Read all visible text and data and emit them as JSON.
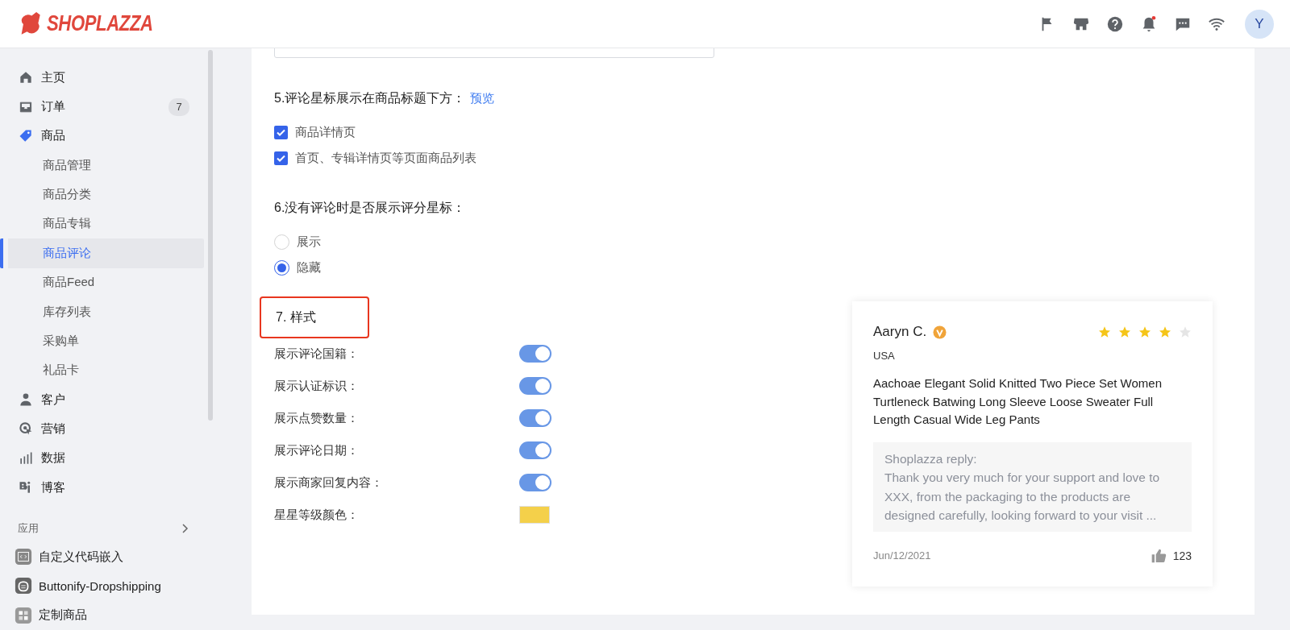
{
  "header": {
    "logo": "SHOPLAZZA",
    "avatar": "Y"
  },
  "sidebar": {
    "items": [
      {
        "label": "主页",
        "selected": false
      },
      {
        "label": "订单",
        "badge": "7",
        "selected": false
      },
      {
        "label": "商品",
        "selected": false,
        "children": [
          {
            "label": "商品管理",
            "selected": false
          },
          {
            "label": "商品分类",
            "selected": false
          },
          {
            "label": "商品专辑",
            "selected": false
          },
          {
            "label": "商品评论",
            "selected": true
          },
          {
            "label": "商品Feed",
            "selected": false
          },
          {
            "label": "库存列表",
            "selected": false
          },
          {
            "label": "采购单",
            "selected": false
          },
          {
            "label": "礼品卡",
            "selected": false
          }
        ]
      },
      {
        "label": "客户",
        "selected": false
      },
      {
        "label": "营销",
        "selected": false
      },
      {
        "label": "数据",
        "selected": false
      },
      {
        "label": "博客",
        "selected": false
      }
    ],
    "apps": {
      "title": "应用",
      "items": [
        "自定义代码嵌入",
        "Buttonify-Dropshipping",
        "定制商品"
      ]
    }
  },
  "sections": [
    {
      "kind": "checkboxes",
      "title": "5.评论星标展示在商品标题下方：",
      "link": "预览",
      "options": [
        {
          "label": "商品详情页",
          "checked": true
        },
        {
          "label": "首页、专辑详情页等页面商品列表",
          "checked": true
        }
      ]
    },
    {
      "kind": "radios",
      "title": "6.没有评论时是否展示评分星标：",
      "options": [
        {
          "label": "展示",
          "selected": false
        },
        {
          "label": "隐藏",
          "selected": true
        }
      ]
    },
    {
      "kind": "settings",
      "title": "7. 样式",
      "highlighted": true,
      "rows": [
        {
          "kind": "toggle",
          "label": "展示评论国籍：",
          "on": true
        },
        {
          "kind": "toggle",
          "label": "展示认证标识：",
          "on": true
        },
        {
          "kind": "toggle",
          "label": "展示点赞数量：",
          "on": true
        },
        {
          "kind": "toggle",
          "label": "展示评论日期：",
          "on": true
        },
        {
          "kind": "toggle",
          "label": "展示商家回复内容：",
          "on": true
        },
        {
          "kind": "color",
          "label": "星星等级颜色：",
          "color": "#f4d04a"
        }
      ]
    }
  ],
  "review": {
    "name": "Aaryn C.",
    "verified": true,
    "stars": 4,
    "country": "USA",
    "text": "Aachoae Elegant Solid Knitted Two Piece Set Women Turtleneck Batwing Long Sleeve Loose Sweater Full Length Casual Wide Leg Pants",
    "reply": {
      "title": "Shoplazza reply:",
      "text": "Thank you very much for your support and love to XXX, from the packaging to the products are designed carefully, looking forward to your visit ..."
    },
    "date": "Jun/12/2021",
    "likes": "123"
  }
}
